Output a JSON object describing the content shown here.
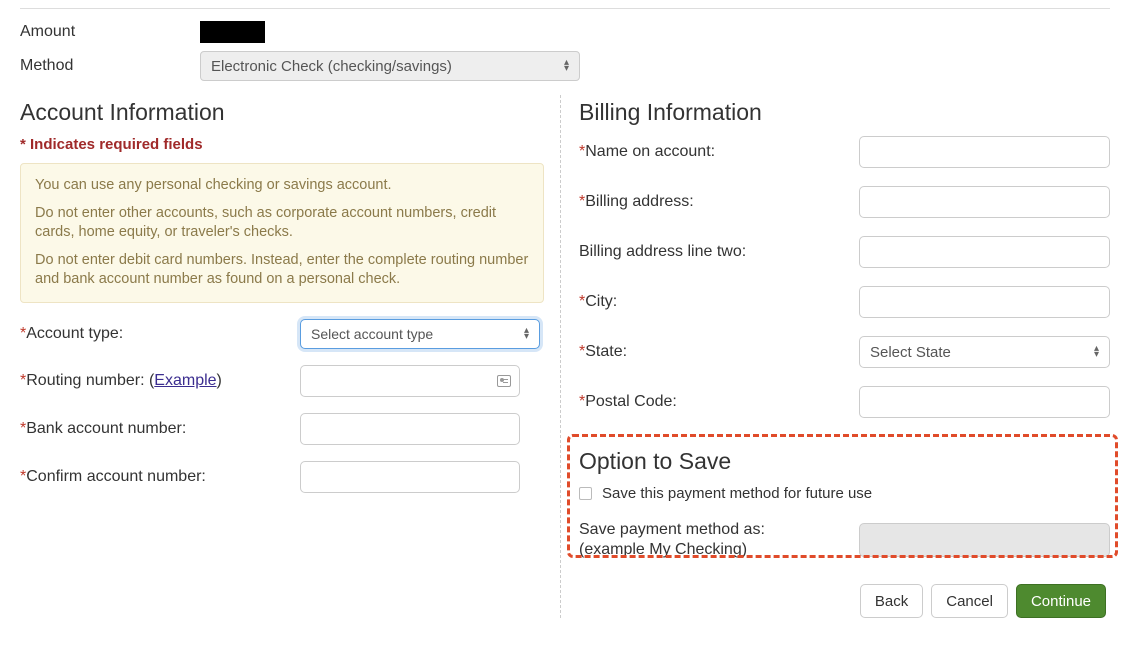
{
  "top": {
    "amount_label": "Amount",
    "method_label": "Method",
    "method_value": "Electronic Check (checking/savings)"
  },
  "account": {
    "heading": "Account Information",
    "required_note": "* Indicates required fields",
    "info_p1": "You can use any personal checking or savings account.",
    "info_p2": "Do not enter other accounts, such as corporate account numbers, credit cards, home equity, or traveler's checks.",
    "info_p3": "Do not enter debit card numbers. Instead, enter the complete routing number and bank account number as found on a personal check.",
    "account_type_label": "Account type:",
    "account_type_placeholder": "Select account type",
    "routing_label_pre": "Routing number: (",
    "routing_example": "Example",
    "routing_label_post": ")",
    "bank_account_label": "Bank account number:",
    "confirm_account_label": "Confirm account number:"
  },
  "billing": {
    "heading": "Billing Information",
    "name_label": "Name on account:",
    "address_label": "Billing address:",
    "address2_label": "Billing address line two:",
    "city_label": "City:",
    "state_label": "State:",
    "state_placeholder": "Select State",
    "postal_label": "Postal Code:"
  },
  "save": {
    "heading": "Option to Save",
    "checkbox_label": "Save this payment method for future use",
    "save_as_label": "Save payment method as:",
    "save_as_hint": "(example My Checking)"
  },
  "buttons": {
    "back": "Back",
    "cancel": "Cancel",
    "continue": "Continue"
  }
}
